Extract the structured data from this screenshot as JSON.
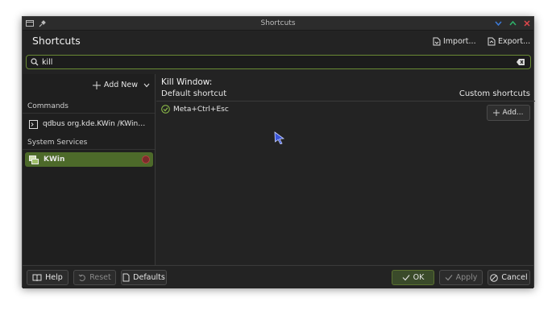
{
  "window": {
    "title": "Shortcuts",
    "heading": "Shortcuts",
    "import_label": "Import...",
    "export_label": "Export..."
  },
  "search": {
    "value": "kill"
  },
  "sidebar": {
    "add_new_label": "Add New",
    "commands_header": "Commands",
    "command_item": "qdbus org.kde.KWin /KWin kill...",
    "system_services_header": "System Services",
    "service_item": "KWin"
  },
  "detail": {
    "title": "Kill Window:",
    "default_header": "Default shortcut",
    "custom_header": "Custom shortcuts",
    "default_shortcut": "Meta+Ctrl+Esc",
    "add_label": "Add..."
  },
  "footer": {
    "help": "Help",
    "reset": "Reset",
    "defaults": "Defaults",
    "ok": "OK",
    "apply": "Apply",
    "cancel": "Cancel"
  },
  "colors": {
    "accent": "#4d6a2a",
    "close": "#e0474c",
    "maximize": "#2fb36b",
    "minimize": "#3d7bd9"
  }
}
